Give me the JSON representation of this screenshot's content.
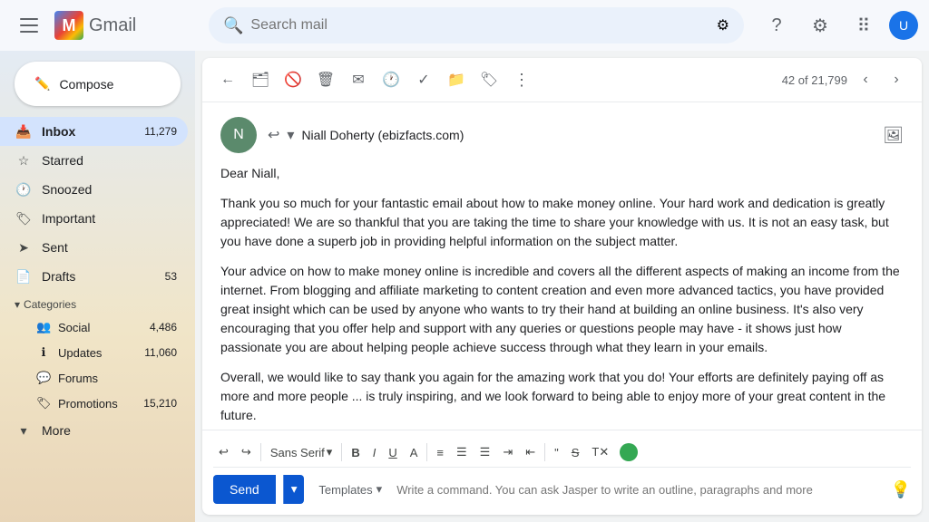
{
  "topbar": {
    "search_placeholder": "Search mail",
    "gmail_text": "Gmail"
  },
  "sidebar": {
    "compose_label": "Compose",
    "items": [
      {
        "id": "inbox",
        "label": "Inbox",
        "count": "11,279",
        "active": true
      },
      {
        "id": "starred",
        "label": "Starred",
        "count": ""
      },
      {
        "id": "snoozed",
        "label": "Snoozed",
        "count": ""
      },
      {
        "id": "important",
        "label": "Important",
        "count": ""
      },
      {
        "id": "sent",
        "label": "Sent",
        "count": ""
      },
      {
        "id": "drafts",
        "label": "Drafts",
        "count": "53"
      }
    ],
    "categories_label": "Categories",
    "categories": [
      {
        "id": "social",
        "label": "Social",
        "count": "4,486"
      },
      {
        "id": "updates",
        "label": "Updates",
        "count": "11,060"
      },
      {
        "id": "forums",
        "label": "Forums",
        "count": ""
      },
      {
        "id": "promotions",
        "label": "Promotions",
        "count": "15,210"
      }
    ],
    "more_label": "More"
  },
  "email_toolbar": {
    "count_text": "42 of 21,799"
  },
  "email": {
    "sender_name": "Niall Doherty (ebizfacts.com)",
    "sender_initial": "N",
    "subject": "",
    "body_paragraphs": [
      "Dear Niall,",
      "Thank you so much for your fantastic email about how to make money online. Your hard work and dedication is greatly appreciated! We are so thankful that you are taking the time to share your knowledge with us. It is not an easy task, but you have done a superb job in providing helpful information on the subject matter.",
      "Your advice on how to make money online is incredible and covers all the different aspects of making an income from the internet. From blogging and affiliate marketing to content creation and even more advanced tactics, you have provided great insight which can be used by anyone who wants to try their hand at building an online business. It's also very encouraging that you offer help and support with any queries or questions people may have - it shows just how passionate you are about helping people achieve success through what they learn in your emails.",
      "Overall, we would like to say thank you again for the amazing work that you do! Your efforts are definitely paying off as more and more people ... is truly inspiring, and we look forward to being able to enjoy more of your great content in the future."
    ]
  },
  "format_toolbar": {
    "undo": "↩",
    "redo": "↪",
    "font_family": "Sans Serif",
    "font_size_arrow": "▾",
    "bold": "B",
    "italic": "I",
    "underline": "U",
    "text_color": "A",
    "align_left": "≡",
    "numbered_list": "≡",
    "bullet_list": "≡",
    "indent": "→",
    "outdent": "←",
    "blockquote": "❝",
    "strikethrough": "S",
    "remove_format": "Tx"
  },
  "compose": {
    "send_label": "Send",
    "templates_label": "Templates",
    "jasper_placeholder": "Write a command. You can ask Jasper to write an outline, paragraphs and more",
    "send_dropdown_arrow": "▾"
  }
}
